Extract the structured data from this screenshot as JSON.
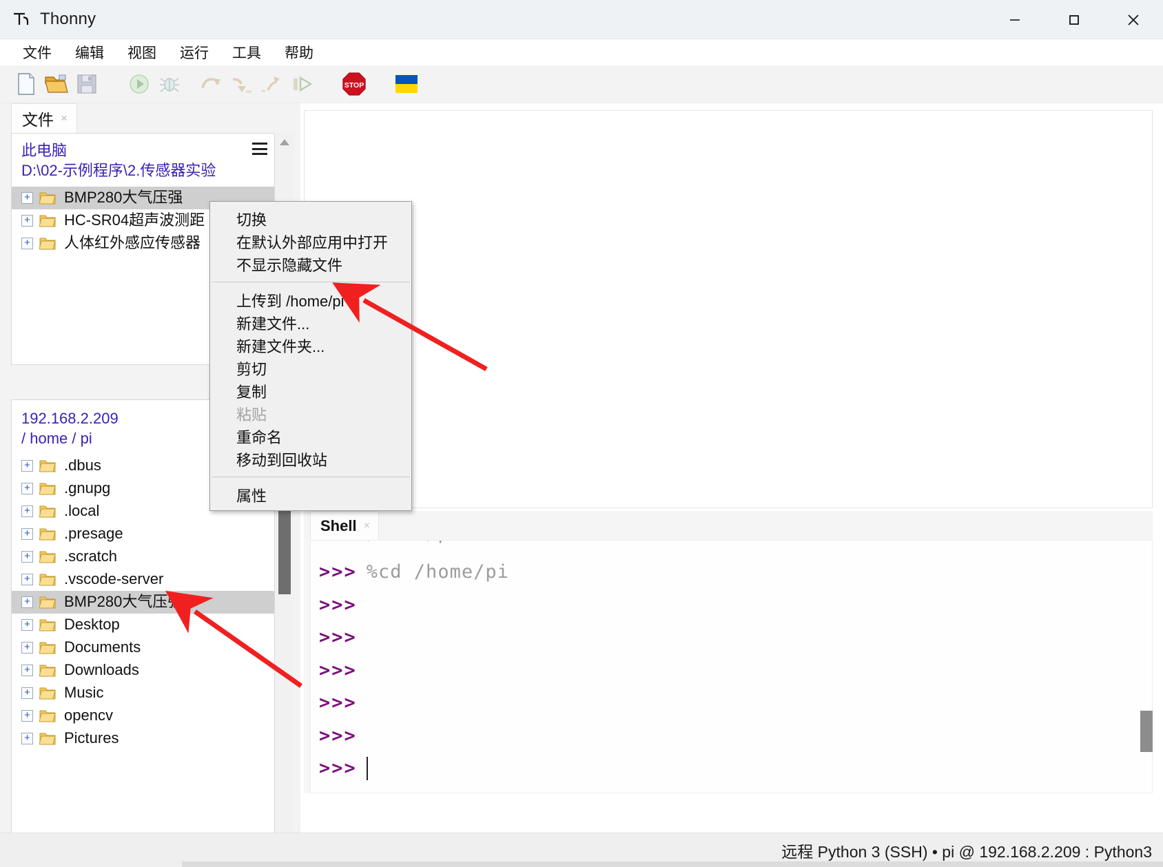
{
  "window": {
    "title": "Thonny",
    "icon": "thonny-logo-icon",
    "minimize_label": "最小化",
    "maximize_label": "最大化",
    "close_label": "关闭"
  },
  "menubar": {
    "items": [
      {
        "label": "文件",
        "name": "menu-file"
      },
      {
        "label": "编辑",
        "name": "menu-edit"
      },
      {
        "label": "视图",
        "name": "menu-view"
      },
      {
        "label": "运行",
        "name": "menu-run"
      },
      {
        "label": "工具",
        "name": "menu-tools"
      },
      {
        "label": "帮助",
        "name": "menu-help"
      }
    ]
  },
  "toolbar": {
    "buttons": [
      {
        "name": "new-file-icon",
        "tip": "新建"
      },
      {
        "name": "open-file-icon",
        "tip": "打开"
      },
      {
        "name": "save-file-icon",
        "tip": "保存"
      },
      {
        "name": "run-icon",
        "tip": "运行"
      },
      {
        "name": "debug-icon",
        "tip": "调试"
      },
      {
        "name": "step-over-icon",
        "tip": "跳过"
      },
      {
        "name": "step-into-icon",
        "tip": "步入"
      },
      {
        "name": "step-out-icon",
        "tip": "步出"
      },
      {
        "name": "resume-icon",
        "tip": "继续"
      },
      {
        "name": "stop-icon",
        "tip": "停止"
      },
      {
        "name": "ukraine-flag-icon",
        "tip": "Ukraine"
      }
    ]
  },
  "files_panel": {
    "tab": {
      "label": "文件",
      "close": "×"
    },
    "local": {
      "root_label": "此电脑",
      "path_prefix": "D:",
      "path_segments": [
        "02-示例程序",
        "2.传感器实验"
      ],
      "path_display": "D:\\02-示例程序\\2.传感器实验",
      "menu_icon": "hamburger-icon",
      "items": [
        {
          "label": "BMP280大气压强",
          "selected": true
        },
        {
          "label": "HC-SR04超声波测距",
          "selected": false
        },
        {
          "label": "人体红外感应传感器",
          "selected": false
        }
      ]
    },
    "remote": {
      "host": "192.168.2.209",
      "path_display": "/ home / pi",
      "path_segments": [
        "home",
        "pi"
      ],
      "items": [
        {
          "label": ".dbus",
          "selected": false
        },
        {
          "label": ".gnupg",
          "selected": false
        },
        {
          "label": ".local",
          "selected": false
        },
        {
          "label": ".presage",
          "selected": false
        },
        {
          "label": ".scratch",
          "selected": false
        },
        {
          "label": ".vscode-server",
          "selected": false
        },
        {
          "label": "BMP280大气压强",
          "selected": true
        },
        {
          "label": "Desktop",
          "selected": false
        },
        {
          "label": "Documents",
          "selected": false
        },
        {
          "label": "Downloads",
          "selected": false
        },
        {
          "label": "Music",
          "selected": false
        },
        {
          "label": "opencv",
          "selected": false
        },
        {
          "label": "Pictures",
          "selected": false
        }
      ]
    }
  },
  "context_menu": {
    "groups": [
      [
        {
          "label": "切换",
          "disabled": false,
          "name": "ctx-toggle"
        },
        {
          "label": "在默认外部应用中打开",
          "disabled": false,
          "name": "ctx-open-external"
        },
        {
          "label": "不显示隐藏文件",
          "disabled": false,
          "name": "ctx-hide-hidden"
        }
      ],
      [
        {
          "label": "上传到 /home/pi",
          "disabled": false,
          "name": "ctx-upload"
        },
        {
          "label": "新建文件...",
          "disabled": false,
          "name": "ctx-new-file"
        },
        {
          "label": "新建文件夹...",
          "disabled": false,
          "name": "ctx-new-folder"
        },
        {
          "label": "剪切",
          "disabled": false,
          "name": "ctx-cut"
        },
        {
          "label": "复制",
          "disabled": false,
          "name": "ctx-copy"
        },
        {
          "label": "粘贴",
          "disabled": true,
          "name": "ctx-paste"
        },
        {
          "label": "重命名",
          "disabled": false,
          "name": "ctx-rename"
        },
        {
          "label": "移动到回收站",
          "disabled": false,
          "name": "ctx-trash"
        }
      ],
      [
        {
          "label": "属性",
          "disabled": false,
          "name": "ctx-properties"
        }
      ]
    ]
  },
  "shell": {
    "tab": {
      "label": "Shell",
      "close": "×"
    },
    "prompt": ">>>",
    "clipped_line": "%cd /home/pi",
    "lines": [
      {
        "prompt": ">>>",
        "command": "%cd /home/pi",
        "caret": false
      },
      {
        "prompt": ">>>",
        "command": "",
        "caret": false
      },
      {
        "prompt": ">>>",
        "command": "",
        "caret": false
      },
      {
        "prompt": ">>>",
        "command": "",
        "caret": false
      },
      {
        "prompt": ">>>",
        "command": "",
        "caret": false
      },
      {
        "prompt": ">>>",
        "command": "",
        "caret": false
      },
      {
        "prompt": ">>>",
        "command": "",
        "caret": true
      }
    ]
  },
  "statusbar": {
    "text": "远程 Python 3 (SSH)  •  pi @ 192.168.2.209 : Python3"
  },
  "colors": {
    "accent_purple": "#7a0f7a",
    "link_blue": "#3a1fb5",
    "annotation_red": "#f02020",
    "selection_gray": "#cfcfcf",
    "titlebar_bg": "#eef2f5"
  }
}
